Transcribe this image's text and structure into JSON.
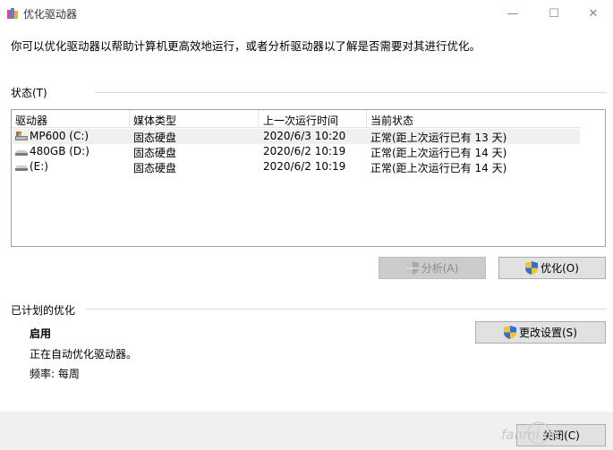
{
  "window": {
    "title": "优化驱动器",
    "minimize_symbol": "—",
    "maximize_symbol": "☐",
    "close_symbol": "✕"
  },
  "intro_text": "你可以优化驱动器以帮助计算机更高效地运行，或者分析驱动器以了解是否需要对其进行优化。",
  "status_section": {
    "label": "状态(T)",
    "columns": [
      "驱动器",
      "媒体类型",
      "上一次运行时间",
      "当前状态"
    ],
    "rows": [
      {
        "drive": "MP600 (C:)",
        "media": "固态硬盘",
        "last_run": "2020/6/3 10:20",
        "status": "正常(距上次运行已有 13 天)",
        "icon": "system-drive-icon"
      },
      {
        "drive": "480GB (D:)",
        "media": "固态硬盘",
        "last_run": "2020/6/2 10:19",
        "status": "正常(距上次运行已有 14 天)",
        "icon": "drive-icon"
      },
      {
        "drive": "(E:)",
        "media": "固态硬盘",
        "last_run": "2020/6/2 10:19",
        "status": "正常(距上次运行已有 14 天)",
        "icon": "drive-icon"
      }
    ],
    "analyze_label": "分析(A)",
    "optimize_label": "优化(O)"
  },
  "schedule_section": {
    "label": "已计划的优化",
    "status": "启用",
    "description": "正在自动优化驱动器。",
    "frequency": "频率: 每周",
    "change_settings_label": "更改设置(S)"
  },
  "footer": {
    "close_label": "关闭(C)"
  },
  "watermark_text": "fahmi.cn",
  "colors": {
    "selection": "#e5f3ff",
    "button_face": "#e1e1e1",
    "footer_bg": "#f0f0f0"
  }
}
